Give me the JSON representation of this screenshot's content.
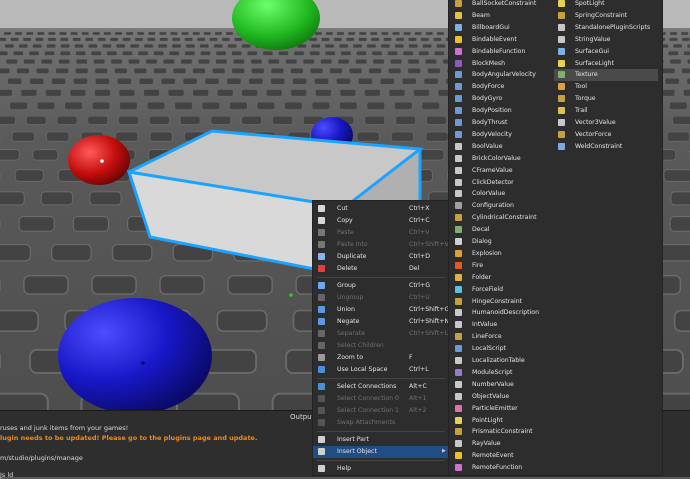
{
  "output_panel": {
    "title": "Output",
    "lines": [
      {
        "text": "ruses and junk items from your games!",
        "style": "white"
      },
      {
        "text": "lugin needs to be updated! Please go to the plugins page and update.",
        "style": "orange"
      },
      {
        "text": "m/studio/plugins/manage",
        "style": "white"
      },
      {
        "text": "Js ld",
        "style": "white"
      }
    ]
  },
  "context_menu": {
    "items": [
      {
        "label": "Cut",
        "shortcut": "Ctrl+X",
        "icon": "scissors-icon",
        "color": "#d8d8d8",
        "disabled": false
      },
      {
        "label": "Copy",
        "shortcut": "Ctrl+C",
        "icon": "copy-icon",
        "color": "#d8d8d8",
        "disabled": false
      },
      {
        "label": "Paste",
        "shortcut": "Ctrl+V",
        "icon": "paste-icon",
        "color": "#777777",
        "disabled": true
      },
      {
        "label": "Paste Into",
        "shortcut": "Ctrl+Shift+V",
        "icon": "paste-into-icon",
        "color": "#777777",
        "disabled": true
      },
      {
        "label": "Duplicate",
        "shortcut": "Ctrl+D",
        "icon": "duplicate-icon",
        "color": "#8ab4f0",
        "disabled": false
      },
      {
        "label": "Delete",
        "shortcut": "Del",
        "icon": "delete-icon",
        "color": "#e04040",
        "disabled": false
      },
      {
        "sep": true
      },
      {
        "label": "Group",
        "shortcut": "Ctrl+G",
        "icon": "group-icon",
        "color": "#6aa8f0",
        "disabled": false
      },
      {
        "label": "Ungroup",
        "shortcut": "Ctrl+U",
        "icon": "ungroup-icon",
        "color": "#666666",
        "disabled": true
      },
      {
        "label": "Union",
        "shortcut": "Ctrl+Shift+G",
        "icon": "union-icon",
        "color": "#5a9ae0",
        "disabled": false
      },
      {
        "label": "Negate",
        "shortcut": "Ctrl+Shift+N",
        "icon": "negate-icon",
        "color": "#5a9ae0",
        "disabled": false
      },
      {
        "label": "Separate",
        "shortcut": "Ctrl+Shift+U",
        "icon": "separate-icon",
        "color": "#666666",
        "disabled": true
      },
      {
        "label": "Select Children",
        "shortcut": "",
        "icon": "select-children-icon",
        "color": "#666666",
        "disabled": true
      },
      {
        "label": "Zoom to",
        "shortcut": "F",
        "icon": "zoom-icon",
        "color": "#9a9a9a",
        "disabled": false
      },
      {
        "label": "Use Local Space",
        "shortcut": "Ctrl+L",
        "icon": "local-space-icon",
        "color": "#4a90d9",
        "disabled": false
      },
      {
        "sep": true
      },
      {
        "label": "Select Connections",
        "shortcut": "Alt+C",
        "icon": "select-connections-icon",
        "color": "#4a90d9",
        "disabled": false
      },
      {
        "label": "Select Connection 0",
        "shortcut": "Alt+1",
        "icon": "connection-0-icon",
        "color": "#555555",
        "disabled": true
      },
      {
        "label": "Select Connection 1",
        "shortcut": "Alt+2",
        "icon": "connection-1-icon",
        "color": "#555555",
        "disabled": true
      },
      {
        "label": "Swap Attachments",
        "shortcut": "",
        "icon": "swap-attachments-icon",
        "color": "#555555",
        "disabled": true
      },
      {
        "sep": true
      },
      {
        "label": "Insert Part",
        "shortcut": "",
        "icon": "insert-part-icon",
        "color": "#cfcfcf",
        "disabled": false
      },
      {
        "label": "Insert Object",
        "shortcut": "",
        "icon": "insert-object-icon",
        "color": "#cfcfcf",
        "disabled": false,
        "submenu": true,
        "highlighted": true
      },
      {
        "sep": true
      },
      {
        "label": "Help",
        "shortcut": "",
        "icon": "help-icon",
        "color": "#cfcfcf",
        "disabled": false
      }
    ]
  },
  "submenu_arrow": "▶",
  "insert_menu": {
    "col1": [
      {
        "label": "BallSocketConstraint",
        "icon": "ballsocket-icon",
        "color": "#c8a040"
      },
      {
        "label": "Beam",
        "icon": "beam-icon",
        "color": "#e0c050"
      },
      {
        "label": "BillboardGui",
        "icon": "billboard-icon",
        "color": "#7fb0e0"
      },
      {
        "label": "BindableEvent",
        "icon": "bindable-event-icon",
        "color": "#e8c030"
      },
      {
        "label": "BindableFunction",
        "icon": "bindable-function-icon",
        "color": "#d070d0"
      },
      {
        "label": "BlockMesh",
        "icon": "blockmesh-icon",
        "color": "#8e5cc0"
      },
      {
        "label": "BodyAngularVelocity",
        "icon": "body-angular-velocity-icon",
        "color": "#6a9ad8"
      },
      {
        "label": "BodyForce",
        "icon": "body-force-icon",
        "color": "#6a9ad8"
      },
      {
        "label": "BodyGyro",
        "icon": "body-gyro-icon",
        "color": "#6a9ad8"
      },
      {
        "label": "BodyPosition",
        "icon": "body-position-icon",
        "color": "#6a9ad8"
      },
      {
        "label": "BodyThrust",
        "icon": "body-thrust-icon",
        "color": "#6a9ad8"
      },
      {
        "label": "BodyVelocity",
        "icon": "body-velocity-icon",
        "color": "#6a9ad8"
      },
      {
        "label": "BoolValue",
        "icon": "boolvalue-icon",
        "color": "#c8c8c8"
      },
      {
        "label": "BrickColorValue",
        "icon": "brickcolor-icon",
        "color": "#c8c8c8"
      },
      {
        "label": "CFrameValue",
        "icon": "cframe-icon",
        "color": "#c8c8c8"
      },
      {
        "label": "ClickDetector",
        "icon": "click-detector-icon",
        "color": "#c8c8c8"
      },
      {
        "label": "ColorValue",
        "icon": "color-value-icon",
        "color": "#c8c8c8"
      },
      {
        "label": "Configuration",
        "icon": "configuration-icon",
        "color": "#a0a0a0"
      },
      {
        "label": "CylindricalConstraint",
        "icon": "cylindrical-icon",
        "color": "#c8a040"
      },
      {
        "label": "Decal",
        "icon": "decal-icon",
        "color": "#80b070"
      },
      {
        "label": "Dialog",
        "icon": "dialog-icon",
        "color": "#d0d0d0"
      },
      {
        "label": "Explosion",
        "icon": "explosion-icon",
        "color": "#e0a030"
      },
      {
        "label": "Fire",
        "icon": "fire-icon",
        "color": "#e05a20"
      },
      {
        "label": "Folder",
        "icon": "folder-icon",
        "color": "#e0b040"
      },
      {
        "label": "ForceField",
        "icon": "forcefield-icon",
        "color": "#60c0e0"
      },
      {
        "label": "HingeConstraint",
        "icon": "hinge-icon",
        "color": "#c8a040"
      },
      {
        "label": "HumanoidDescription",
        "icon": "humanoid-description-icon",
        "color": "#c8c8c8"
      },
      {
        "label": "IntValue",
        "icon": "intvalue-icon",
        "color": "#c8c8c8"
      },
      {
        "label": "LineForce",
        "icon": "lineforce-icon",
        "color": "#c8a040"
      },
      {
        "label": "LocalScript",
        "icon": "localscript-icon",
        "color": "#6a9ad8"
      },
      {
        "label": "LocalizationTable",
        "icon": "localization-icon",
        "color": "#c8c8c8"
      },
      {
        "label": "ModuleScript",
        "icon": "modulescript-icon",
        "color": "#9a7ad0"
      },
      {
        "label": "NumberValue",
        "icon": "numbervalue-icon",
        "color": "#c8c8c8"
      },
      {
        "label": "ObjectValue",
        "icon": "objectvalue-icon",
        "color": "#c8c8c8"
      },
      {
        "label": "ParticleEmitter",
        "icon": "particle-icon",
        "color": "#e070b0"
      },
      {
        "label": "PointLight",
        "icon": "pointlight-icon",
        "color": "#e8d050"
      },
      {
        "label": "PrismaticConstraint",
        "icon": "prismatic-icon",
        "color": "#c8a040"
      },
      {
        "label": "RayValue",
        "icon": "rayvalue-icon",
        "color": "#c8c8c8"
      },
      {
        "label": "RemoteEvent",
        "icon": "remote-event-icon",
        "color": "#e8c030"
      },
      {
        "label": "RemoteFunction",
        "icon": "remote-function-icon",
        "color": "#d070d0"
      }
    ],
    "col2": [
      {
        "label": "SpotLight",
        "icon": "spotlight-icon",
        "color": "#e8d050"
      },
      {
        "label": "SpringConstraint",
        "icon": "spring-icon",
        "color": "#c8a040"
      },
      {
        "label": "StandalonePluginScripts",
        "icon": "standalone-plugin-icon",
        "color": "#c8c8c8"
      },
      {
        "label": "StringValue",
        "icon": "stringvalue-icon",
        "color": "#c8c8c8"
      },
      {
        "label": "SurfaceGui",
        "icon": "surfacegui-icon",
        "color": "#7fb0e0"
      },
      {
        "label": "SurfaceLight",
        "icon": "surfacelight-icon",
        "color": "#e8d050"
      },
      {
        "label": "Texture",
        "icon": "texture-icon",
        "color": "#80b070",
        "highlighted": true
      },
      {
        "label": "Tool",
        "icon": "tool-icon",
        "color": "#e0a040"
      },
      {
        "label": "Torque",
        "icon": "torque-icon",
        "color": "#c8a040"
      },
      {
        "label": "Trail",
        "icon": "trail-icon",
        "color": "#e0c050"
      },
      {
        "label": "Vector3Value",
        "icon": "vector3-icon",
        "color": "#c8c8c8"
      },
      {
        "label": "VectorForce",
        "icon": "vectorforce-icon",
        "color": "#c8a040"
      },
      {
        "label": "WeldConstraint",
        "icon": "weld-icon",
        "color": "#7aaae0"
      }
    ]
  },
  "scene_colors": {
    "baseplate": "#555555",
    "tile": "#6a6a6a",
    "tile_hole": "#434343",
    "part_top": "#c9c9c9",
    "part_front": "#d8d8d8",
    "part_side": "#b3b3b3",
    "selection": "#1aa3ff",
    "sphere_red": "#d01010",
    "sphere_blue": "#1a1ad8",
    "sphere_green": "#22c022"
  }
}
